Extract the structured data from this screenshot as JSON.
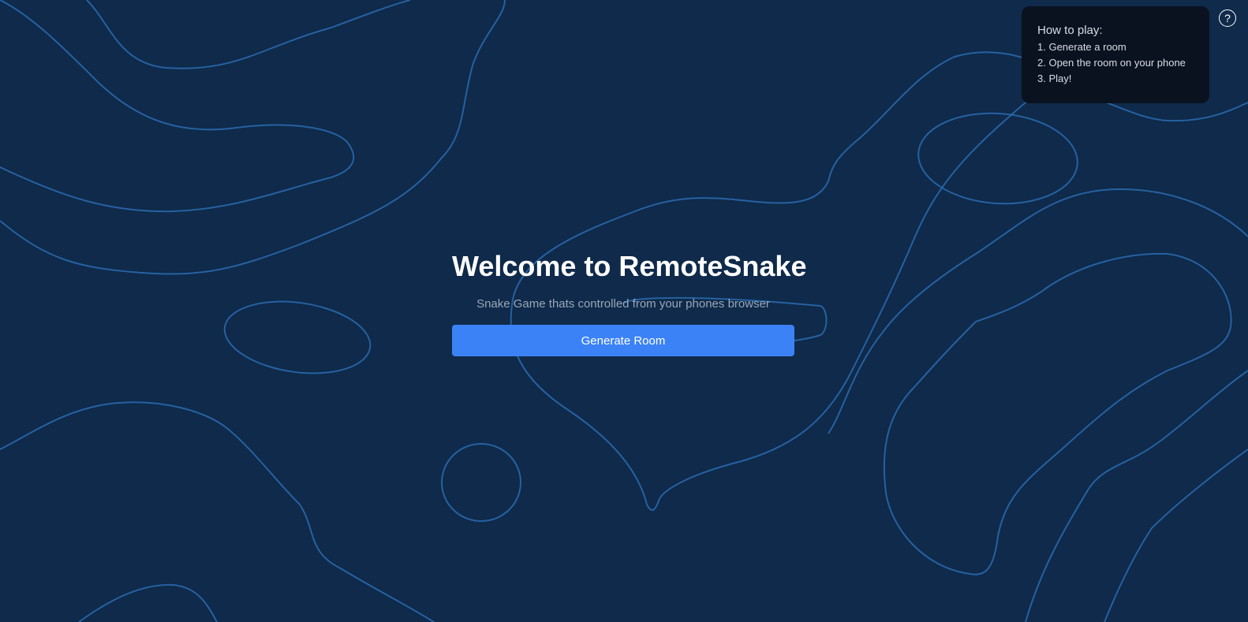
{
  "hero": {
    "title": "Welcome to RemoteSnake",
    "subtitle": "Snake Game thats controlled from your phones browser",
    "generate_label": "Generate Room"
  },
  "how_to": {
    "title": "How to play:",
    "steps": [
      "1. Generate a room",
      "2. Open the room on your phone",
      "3. Play!"
    ]
  },
  "help": {
    "icon": "question-circle-icon",
    "glyph": "?"
  },
  "colors": {
    "background": "#0f2a4a",
    "contour": "#2a6bb0",
    "accent": "#3b82f6",
    "panel": "#0a1220"
  }
}
